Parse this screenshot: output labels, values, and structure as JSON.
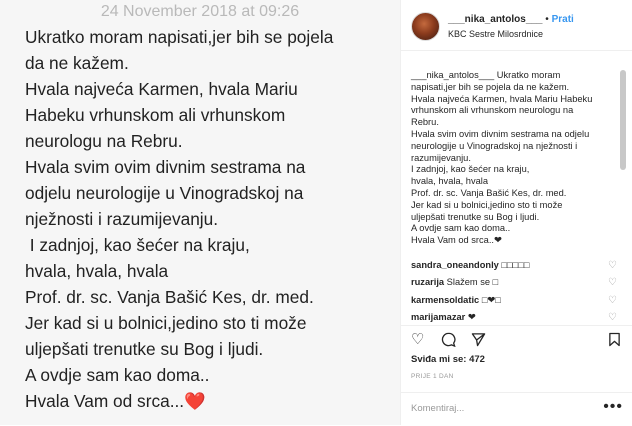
{
  "story": {
    "timestamp": "24 November 2018 at 09:26",
    "lines": [
      "Ukratko moram napisati,jer bih se pojela",
      "da ne kažem.",
      "Hvala najveća Karmen, hvala Mariu",
      "Habeku vrhunskom ali vrhunskom",
      "neurologu na Rebru.",
      "Hvala svim ovim divnim sestrama na",
      "odjelu neurologije u Vinogradskoj na",
      "nježnosti i razumijevanju.",
      " I zadnjoj, kao šećer na kraju,",
      "hvala, hvala, hvala",
      "Prof. dr. sc. Vanja Bašić Kes, dr. med.",
      "Jer kad si u bolnici,jedino sto ti može",
      "uljepšati trenutke su Bog i ljudi.",
      "A ovdje sam kao doma..",
      "Hvala Vam od srca..."
    ],
    "heart": "❤️"
  },
  "post": {
    "username": "___nika_antolos___",
    "separator": "•",
    "follow_label": "Prati",
    "location": "KBC Sestre Milosrdnice",
    "caption_lines": [
      "___nika_antolos___ Ukratko moram",
      "napisati,jer bih se pojela da ne kažem.",
      "Hvala najveća Karmen, hvala Mariu Habeku",
      "vrhunskom ali vrhunskom neurologu na",
      "Rebru.",
      "Hvala svim ovim divnim sestrama na odjelu",
      "neurologije u Vinogradskoj na nježnosti i",
      "razumijevanju.",
      "I zadnjoj, kao šećer na kraju,",
      "hvala, hvala, hvala",
      "Prof. dr. sc. Vanja Bašić Kes, dr. med.",
      "Jer kad si u bolnici,jedino sto ti može",
      "uljepšati trenutke su Bog i ljudi.",
      "A ovdje sam kao doma..",
      "Hvala Vam od srca..❤"
    ],
    "comments": [
      {
        "user": "sandra_oneandonly",
        "text": "□□□□□"
      },
      {
        "user": "ruzarija",
        "text": "Slažem se □"
      },
      {
        "user": "karmensoldatic",
        "text": "□❤□"
      },
      {
        "user": "marijamazar",
        "text": "❤"
      }
    ],
    "likes": "Sviđa mi se: 472",
    "time_ago": "PRIJE 1 DAN",
    "comment_placeholder": "Komentiraj...",
    "more_label": "•••"
  },
  "icons": {
    "like": "heart-icon",
    "comment": "comment-icon",
    "share": "share-icon",
    "save": "bookmark-icon",
    "comment_like": "heart-outline-icon"
  }
}
